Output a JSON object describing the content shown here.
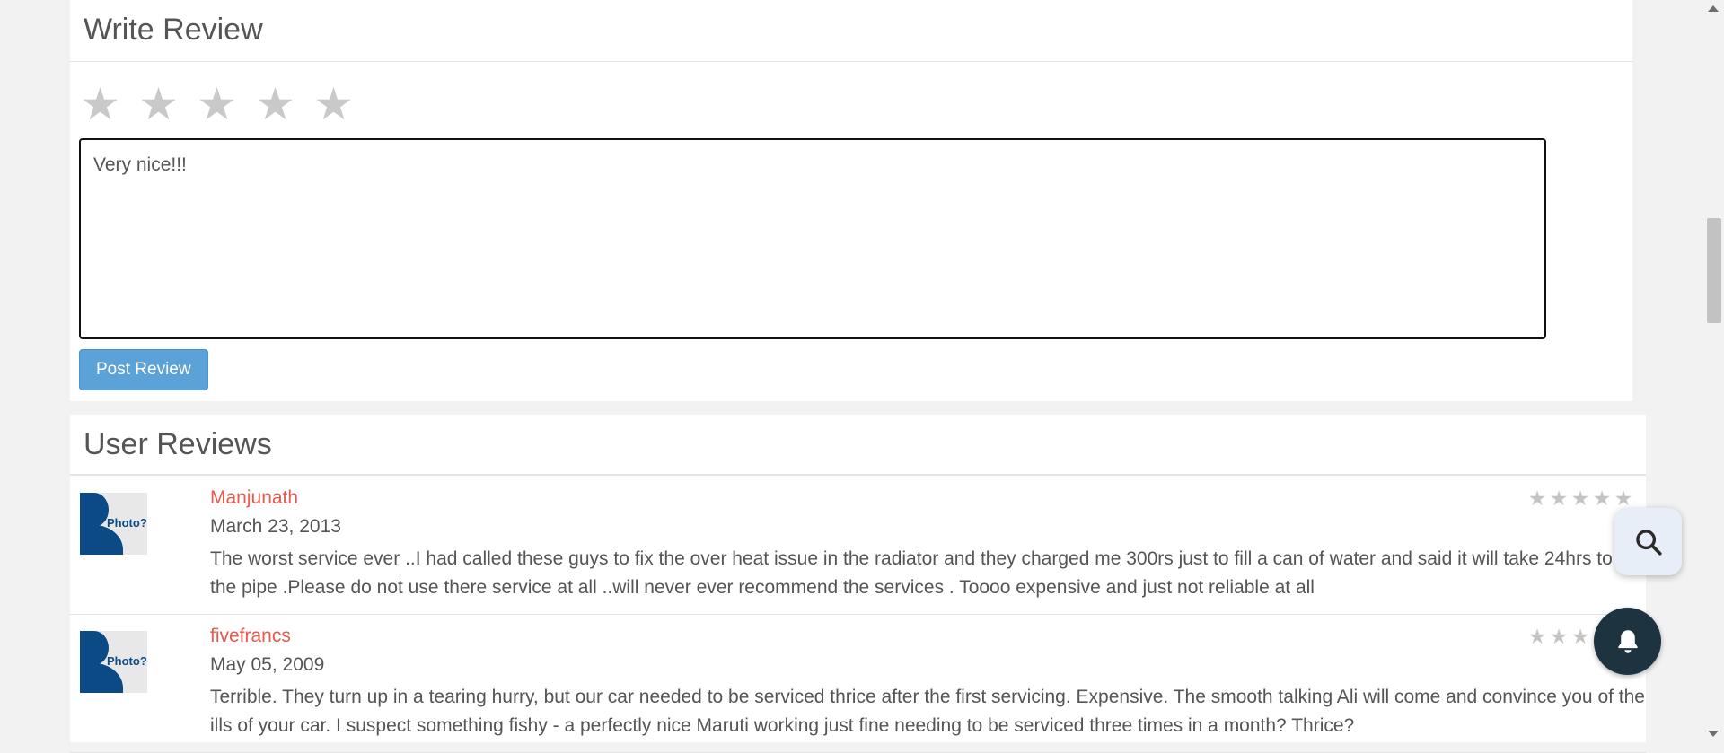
{
  "write_review": {
    "title": "Write Review",
    "stars": [
      "★",
      "★",
      "★",
      "★",
      "★"
    ],
    "rating": 0,
    "textarea_value": "Very nice!!!",
    "post_button_label": "Post Review"
  },
  "user_reviews": {
    "title": "User Reviews",
    "avatar_text": "Photo?",
    "items": [
      {
        "name": "Manjunath",
        "date": "March 23, 2013",
        "text": "The worst service ever ..I had called these guys to fix the over heat issue in the radiator and they charged me 300rs just to fill a can of water and said it will take 24hrs to fix the pipe .Please do not use there service at all ..will never ever recommend the services . Toooo expensive and just not reliable at all",
        "rating": 0
      },
      {
        "name": "fivefrancs",
        "date": "May 05, 2009",
        "text": "Terrible. They turn up in a tearing hurry, but our car needed to be serviced thrice after the first servicing. Expensive. The smooth talking Ali will come and convince you of the ills of your car. I suspect something fishy - a perfectly nice Maruti working just fine needing to be serviced three times in a month? Thrice?",
        "rating": 0
      }
    ]
  },
  "fab": {
    "search_icon": "search-icon",
    "bell_icon": "bell-icon"
  },
  "colors": {
    "accent_button": "#5aa2d8",
    "reviewer_name": "#e85a4f",
    "star_empty": "#c9c9c9",
    "bell_fab": "#1d3340",
    "search_fab": "#e7eef8"
  }
}
